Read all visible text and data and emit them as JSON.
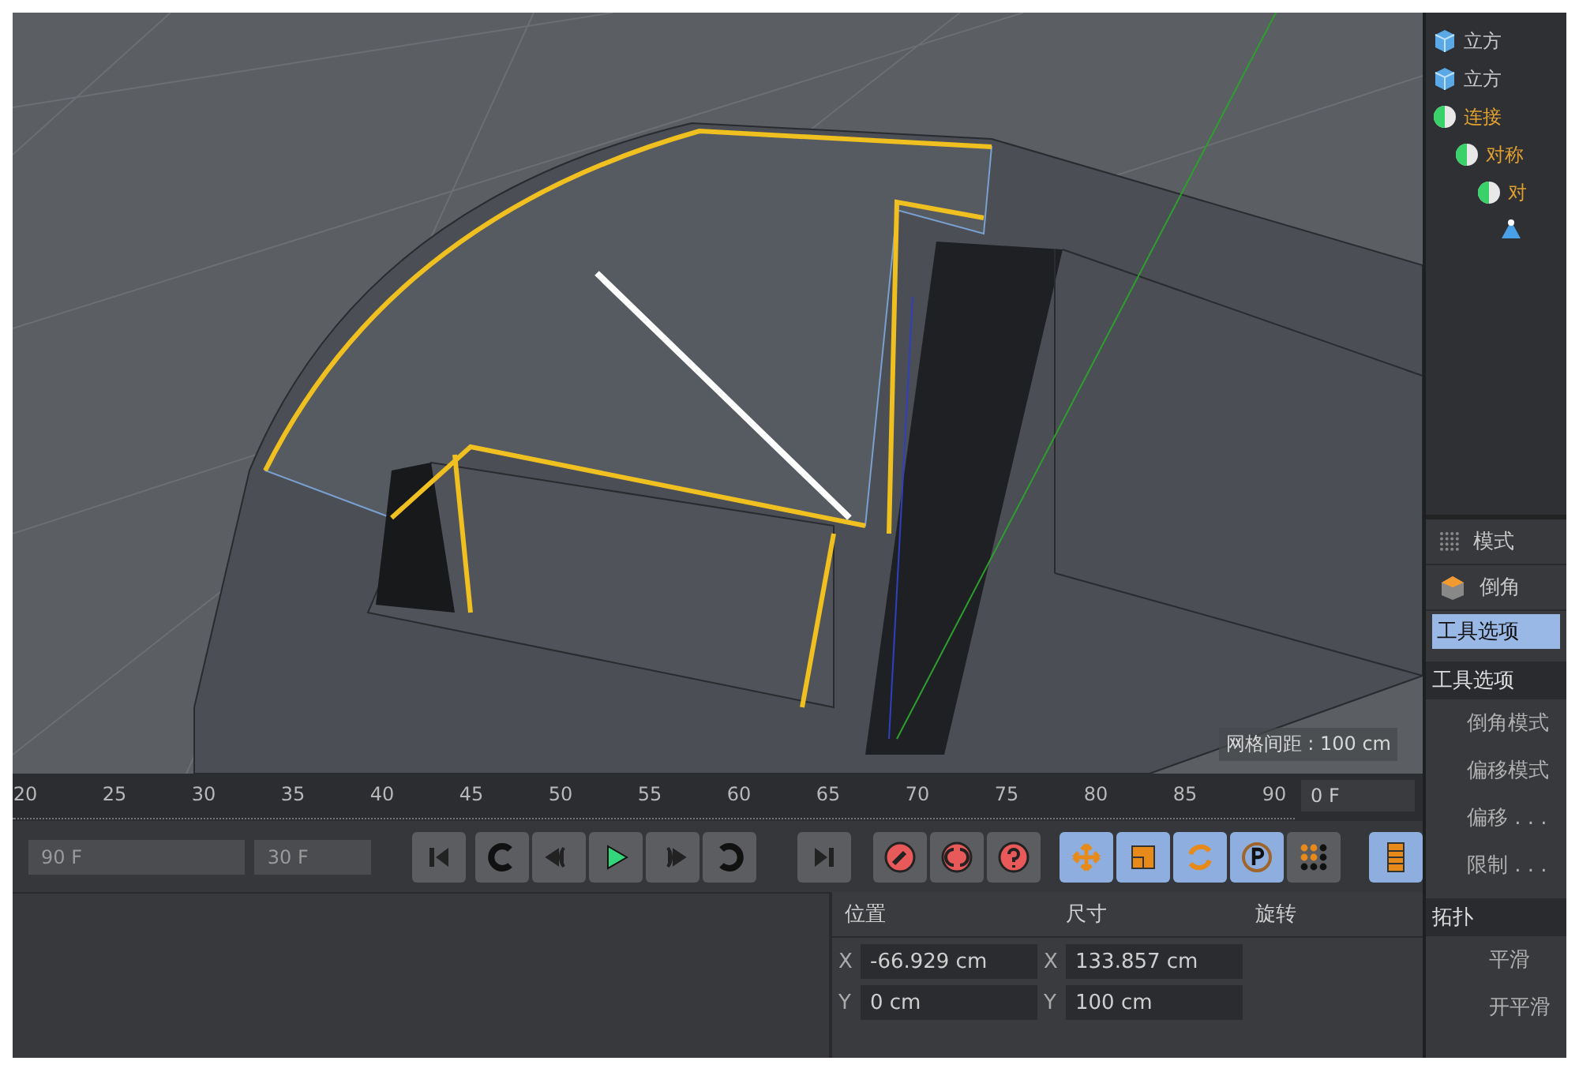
{
  "viewport": {
    "grid_label": "网格间距 : 100 cm"
  },
  "object_tree": [
    {
      "label": "立方",
      "kind": "cube",
      "active": false
    },
    {
      "label": "立方",
      "kind": "cube",
      "active": false
    },
    {
      "label": "连接",
      "kind": "generator",
      "active": true,
      "children": [
        {
          "label": "对称",
          "kind": "generator",
          "active": true,
          "children": [
            {
              "label": "对",
              "kind": "generator",
              "active": true,
              "children": [
                {
                  "kind": "tool"
                }
              ]
            }
          ]
        }
      ]
    }
  ],
  "timeline": {
    "ticks": [
      "20",
      "25",
      "30",
      "35",
      "40",
      "45",
      "50",
      "55",
      "60",
      "65",
      "70",
      "75",
      "80",
      "85",
      "90"
    ],
    "current_frame": "0 F",
    "end_frame": "90 F",
    "preview_frame": "30 F"
  },
  "transport": [
    {
      "kind": "first"
    },
    {
      "kind": "prev_key"
    },
    {
      "kind": "prev_frame"
    },
    {
      "kind": "play"
    },
    {
      "kind": "next_frame"
    },
    {
      "kind": "next_key"
    },
    {
      "kind": "last"
    }
  ],
  "record": [
    {
      "kind": "record"
    },
    {
      "kind": "autokey"
    },
    {
      "kind": "help"
    }
  ],
  "key_tools": [
    {
      "kind": "move",
      "selected": true
    },
    {
      "kind": "scale",
      "selected": true
    },
    {
      "kind": "rotate",
      "selected": true
    },
    {
      "kind": "param",
      "selected": true
    },
    {
      "kind": "points",
      "selected": false
    },
    {
      "kind": "film",
      "selected": true
    }
  ],
  "coordinates": {
    "headers": [
      "位置",
      "尺寸",
      "旋转"
    ],
    "rows": [
      {
        "axis": "X",
        "position": "-66.929 cm",
        "size_axis": "X",
        "size": "133.857 cm"
      },
      {
        "axis": "Y",
        "position": "0 cm",
        "size_axis": "Y",
        "size": "100 cm"
      }
    ]
  },
  "attributes": {
    "mode_tab": "模式",
    "tool_name": "倒角",
    "tabs": [
      {
        "label": "工具选项",
        "selected": true
      }
    ],
    "section": "工具选项",
    "properties": [
      "倒角模式",
      "偏移模式",
      "偏移 . . .",
      "限制 . . ."
    ],
    "section_2": "拓扑",
    "properties_2": [
      "平滑",
      "开平滑"
    ]
  }
}
